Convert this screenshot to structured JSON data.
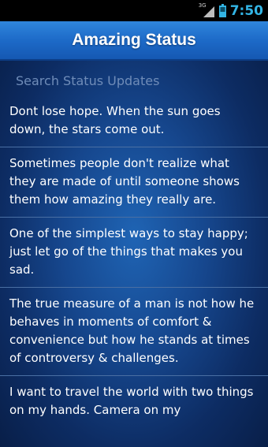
{
  "status_bar": {
    "network": "3G",
    "time": "7:50"
  },
  "header": {
    "title": "Amazing Status"
  },
  "search": {
    "placeholder": "Search Status Updates"
  },
  "statuses": [
    "Dont lose hope. When the sun goes down, the stars come out.",
    "Sometimes people don't realize what they are made of until someone shows them how amazing they really are.",
    "One of the simplest ways to stay happy; just let go of the things that makes you sad.",
    "The true measure of a man is not how he behaves in moments of comfort & convenience but how he stands at times of controversy & challenges.",
    "I want to travel the world with two things on my hands. Camera on my"
  ],
  "colors": {
    "clock": "#33b5e5",
    "title_bar": "#1d6ac8",
    "background": "#16478e",
    "divider": "#4a6fa3",
    "placeholder": "#6f8cb8"
  }
}
